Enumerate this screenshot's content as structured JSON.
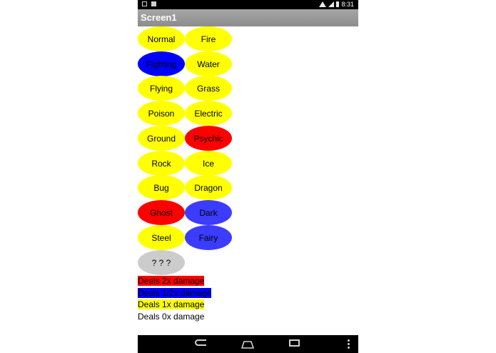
{
  "status_bar": {
    "time": "8:31"
  },
  "screen_title": "Screen1",
  "type_buttons": [
    {
      "label": "Normal",
      "color": "#ffff00"
    },
    {
      "label": "Fire",
      "color": "#ffff00"
    },
    {
      "label": "Fighting",
      "color": "#0000ff"
    },
    {
      "label": "Water",
      "color": "#ffff00"
    },
    {
      "label": "Flying",
      "color": "#ffff00"
    },
    {
      "label": "Grass",
      "color": "#ffff00"
    },
    {
      "label": "Poison",
      "color": "#ffff00"
    },
    {
      "label": "Electric",
      "color": "#ffff00"
    },
    {
      "label": "Ground",
      "color": "#ffff00"
    },
    {
      "label": "Psychic",
      "color": "#ff0000"
    },
    {
      "label": "Rock",
      "color": "#ffff00"
    },
    {
      "label": "Ice",
      "color": "#ffff00"
    },
    {
      "label": "Bug",
      "color": "#ffff00"
    },
    {
      "label": "Dragon",
      "color": "#ffff00"
    },
    {
      "label": "Ghost",
      "color": "#ff0000"
    },
    {
      "label": "Dark",
      "color": "#3c3cff"
    },
    {
      "label": "Steel",
      "color": "#ffff00"
    },
    {
      "label": "Fairy",
      "color": "#3c3cff"
    },
    {
      "label": "? ? ?",
      "color": "#cccccc"
    }
  ],
  "legend": [
    {
      "text": "Deals 2x damage",
      "color": "#ff0000"
    },
    {
      "text": "Deals 1/2x damage",
      "color": "#0000ff"
    },
    {
      "text": "Deals 1x damage",
      "color": "#ffff00"
    },
    {
      "text": "Deals 0x damage",
      "color": "#ffffff"
    }
  ]
}
